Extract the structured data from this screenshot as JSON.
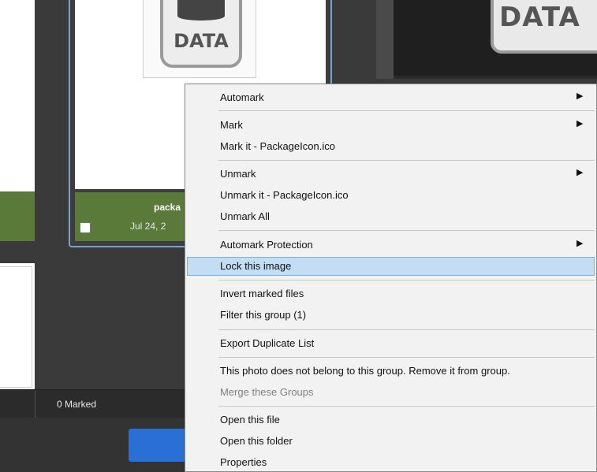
{
  "card": {
    "filename_partial": "packa",
    "date_partial": "Jul 24, 2",
    "icon_text": "DATA"
  },
  "right_preview": {
    "icon_text": "DATA"
  },
  "status": {
    "marked": "0 Marked"
  },
  "context_menu": {
    "items": [
      {
        "label": "Automark",
        "submenu": true
      },
      {
        "label": "Mark",
        "submenu": true
      },
      {
        "label": "Mark it - PackageIcon.ico",
        "submenu": false
      },
      {
        "label": "Unmark",
        "submenu": true
      },
      {
        "label": "Unmark it - PackageIcon.ico",
        "submenu": false
      },
      {
        "label": "Unmark All",
        "submenu": false
      },
      {
        "label": "Automark Protection",
        "submenu": true
      },
      {
        "label": "Lock this image",
        "submenu": false,
        "highlighted": true
      },
      {
        "label": "Invert marked files",
        "submenu": false
      },
      {
        "label": "Filter this group (1)",
        "submenu": false
      },
      {
        "label": "Export Duplicate List",
        "submenu": false
      },
      {
        "label": "This photo does not belong to this group. Remove it from group.",
        "submenu": false
      },
      {
        "label": "Merge these Groups",
        "submenu": false,
        "disabled": true
      },
      {
        "label": "Open this file",
        "submenu": false
      },
      {
        "label": "Open this folder",
        "submenu": false
      },
      {
        "label": "Properties",
        "submenu": false
      }
    ],
    "submenu_arrow": "▶"
  },
  "colors": {
    "group_header_green": "#5a7a3a",
    "selection_border": "#7fa0c8",
    "highlight": "#c3ddf5",
    "primary_button": "#2a6fd6"
  }
}
